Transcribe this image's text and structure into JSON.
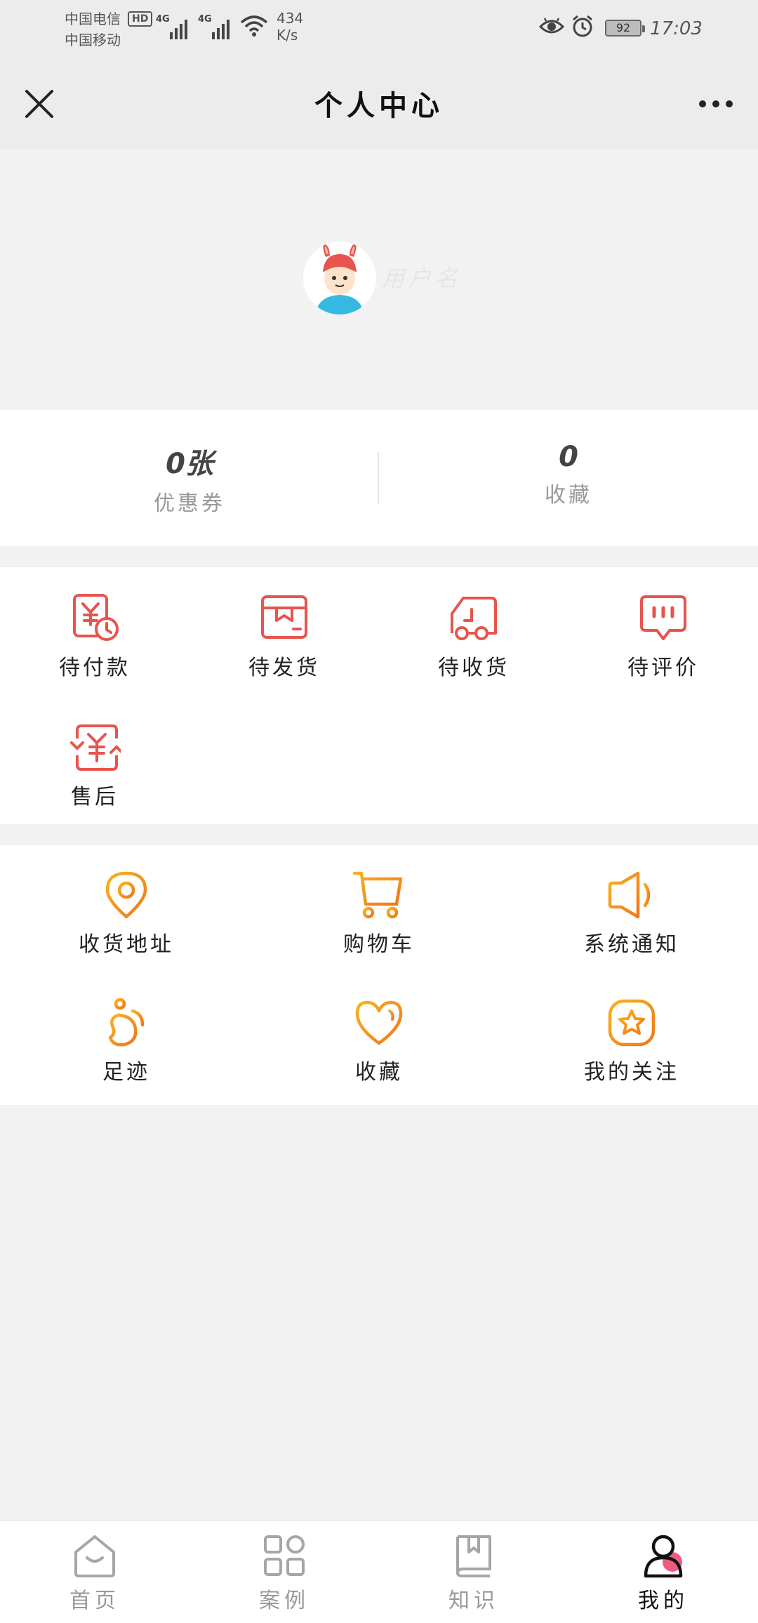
{
  "status_bar": {
    "carrier_1": "中国电信",
    "carrier_2": "中国移动",
    "hd_badge": "HD",
    "sim1_network": "4G",
    "sim2_network": "4G",
    "net_speed_value": "434",
    "net_speed_unit": "K/s",
    "battery": "92",
    "time": "17:03"
  },
  "header": {
    "title": "个人中心"
  },
  "profile": {
    "username": "用户名"
  },
  "stats": {
    "coupons_value": "0张",
    "coupons_label": "优惠券",
    "favorites_value": "0",
    "favorites_label": "收藏"
  },
  "orders": {
    "items": [
      {
        "label": "待付款",
        "icon": "payment-pending-icon"
      },
      {
        "label": "待发货",
        "icon": "box-icon"
      },
      {
        "label": "待收货",
        "icon": "truck-icon"
      },
      {
        "label": "待评价",
        "icon": "comment-icon"
      },
      {
        "label": "售后",
        "icon": "refund-icon"
      }
    ],
    "accent_color": "#e8544e"
  },
  "services": {
    "items": [
      {
        "label": "收货地址",
        "icon": "location-icon"
      },
      {
        "label": "购物车",
        "icon": "cart-icon"
      },
      {
        "label": "系统通知",
        "icon": "speaker-icon"
      },
      {
        "label": "足迹",
        "icon": "footprint-icon"
      },
      {
        "label": "收藏",
        "icon": "heart-icon"
      },
      {
        "label": "我的关注",
        "icon": "star-badge-icon"
      }
    ],
    "accent_color": "#f39a1e"
  },
  "bottom_nav": {
    "items": [
      {
        "label": "首页",
        "icon": "home-icon",
        "active": false
      },
      {
        "label": "案例",
        "icon": "grid-icon",
        "active": false
      },
      {
        "label": "知识",
        "icon": "book-icon",
        "active": false
      },
      {
        "label": "我的",
        "icon": "user-icon",
        "active": true
      }
    ],
    "active_accent": "#ef5b7f"
  }
}
